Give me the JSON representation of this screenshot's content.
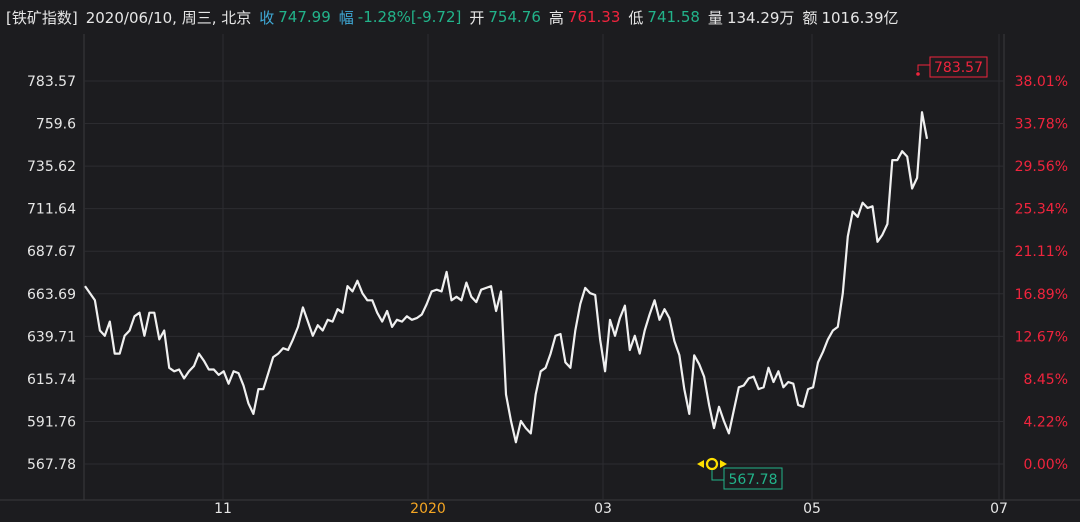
{
  "header": {
    "index_name": "[铁矿指数]",
    "date": "2020/06/10, 周三, 北京",
    "close_label": "收",
    "close_value": "747.99",
    "change_label": "幅",
    "change_pct": "-1.28%",
    "change_abs": "[-9.72]",
    "open_label": "开",
    "open_value": "754.76",
    "high_label": "高",
    "high_value": "761.33",
    "low_label": "低",
    "low_value": "741.58",
    "volume_label": "量",
    "volume_value": "134.29万",
    "amount_label": "额",
    "amount_value": "1016.39亿"
  },
  "colors": {
    "background": "#1c1c1f",
    "line": "#f0f0f0",
    "up": "#f0243d",
    "down": "#22b38a",
    "accent_year": "#f5a623",
    "marker_low": "#ffe000"
  },
  "chart_data": {
    "type": "line",
    "y_left_ticks": [
      "783.57",
      "759.6",
      "735.62",
      "711.64",
      "687.67",
      "663.69",
      "639.71",
      "615.74",
      "591.76",
      "567.78"
    ],
    "y_right_ticks": [
      "38.01%",
      "33.78%",
      "29.56%",
      "25.34%",
      "21.11%",
      "16.89%",
      "12.67%",
      "8.45%",
      "4.22%",
      "0.00%"
    ],
    "ylim": [
      567.78,
      783.57
    ],
    "x_tick_labels": [
      "11",
      "2020",
      "03",
      "05",
      "07"
    ],
    "max_label": "783.57",
    "min_label": "567.78",
    "grid": true,
    "values": [
      668,
      664,
      660,
      643,
      640,
      648,
      630,
      630,
      640,
      643,
      651,
      653,
      640,
      653,
      653,
      638,
      643,
      622,
      620,
      621,
      616,
      620,
      623,
      630,
      626,
      621,
      621,
      618,
      620,
      613,
      620,
      619,
      612,
      602,
      596,
      610,
      610,
      619,
      628,
      630,
      633,
      632,
      638,
      645,
      656,
      648,
      640,
      646,
      643,
      649,
      648,
      655,
      653,
      668,
      665,
      671,
      664,
      660,
      660,
      653,
      648,
      654,
      645,
      649,
      648,
      651,
      649,
      650,
      652,
      658,
      665,
      666,
      665,
      676,
      660,
      662,
      660,
      670,
      662,
      659,
      666,
      667,
      668,
      654,
      665,
      607,
      592,
      580,
      592,
      588,
      585,
      607,
      620,
      622,
      630,
      640,
      641,
      625,
      622,
      643,
      658,
      667,
      664,
      663,
      638,
      620,
      649,
      640,
      650,
      657,
      632,
      640,
      630,
      643,
      652,
      660,
      649,
      655,
      650,
      637,
      629,
      610,
      596,
      629,
      624,
      617,
      601,
      588,
      600,
      592,
      585,
      598,
      611,
      612,
      616,
      617,
      610,
      611,
      622,
      614,
      620,
      611,
      614,
      613,
      601,
      600,
      610,
      611,
      625,
      631,
      638,
      643,
      645,
      664,
      696,
      710,
      707,
      715,
      712,
      713,
      693,
      697,
      703,
      739,
      739,
      744,
      741,
      723,
      729,
      766,
      751
    ]
  }
}
